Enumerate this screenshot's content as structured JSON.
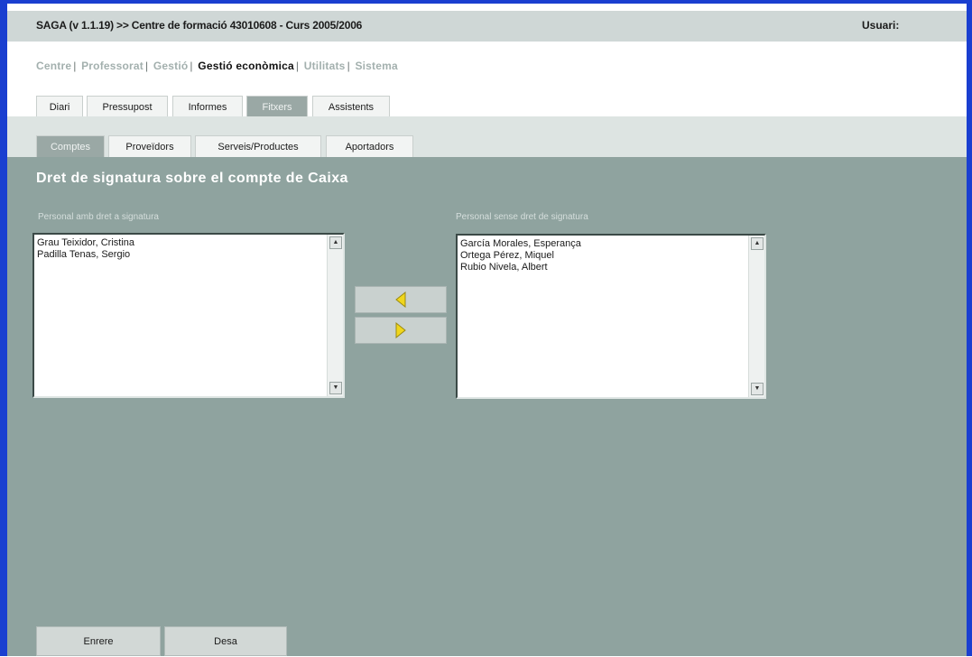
{
  "window": {
    "title": "SAGA (v 1.1.19) >> Centre de formació 43010608 - Curs 2005/2006",
    "user_label": "Usuari:"
  },
  "main_menu": [
    "Centre",
    "Professorat",
    "Gestió",
    "Gestió econòmica",
    "Utilitats",
    "Sistema"
  ],
  "tabs_primary": [
    "Diari",
    "Pressupost",
    "Informes",
    "Fitxers",
    "Assistents"
  ],
  "tabs_secondary": [
    "Comptes",
    "Proveïdors",
    "Serveis/Productes",
    "Aportadors"
  ],
  "page": {
    "heading": "Dret de signatura sobre el compte de Caixa"
  },
  "left_list": {
    "label": "Personal amb dret a signatura",
    "items": [
      "Grau Teixidor, Cristina",
      "Padilla Tenas, Sergio"
    ]
  },
  "right_list": {
    "label": "Personal sense dret de signatura",
    "items": [
      "García Morales, Esperança",
      "Ortega Pérez, Miquel",
      "Rubio Nivela, Albert"
    ]
  },
  "buttons": {
    "back": "Enrere",
    "save": "Desa"
  },
  "icons": {
    "move_left": "arrow-left-icon",
    "move_right": "arrow-right-icon",
    "accent": "#f0d61c"
  }
}
